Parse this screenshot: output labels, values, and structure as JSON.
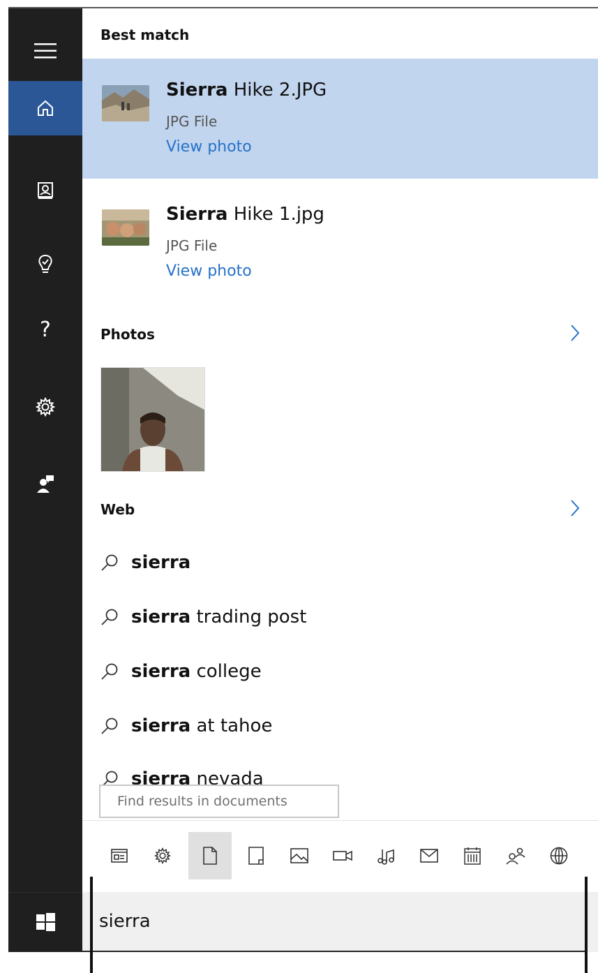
{
  "sections": {
    "best_match": "Best match",
    "photos": "Photos",
    "web": "Web"
  },
  "results": [
    {
      "title_bold": "Sierra",
      "title_rest": " Hike 2.JPG",
      "type": "JPG File",
      "action": "View photo",
      "selected": true
    },
    {
      "title_bold": "Sierra",
      "title_rest": " Hike 1.jpg",
      "type": "JPG File",
      "action": "View photo",
      "selected": false
    }
  ],
  "web_suggestions": [
    {
      "bold": "sierra",
      "rest": ""
    },
    {
      "bold": "sierra",
      "rest": " trading post"
    },
    {
      "bold": "sierra",
      "rest": " college"
    },
    {
      "bold": "sierra",
      "rest": " at tahoe"
    },
    {
      "bold": "sierra",
      "rest": " nevada"
    }
  ],
  "tooltip": "Find results in documents",
  "sidebar_icons": [
    "hamburger-icon",
    "home-icon",
    "notebook-icon",
    "lightbulb-icon",
    "help-icon",
    "gear-icon",
    "feedback-icon"
  ],
  "filter_icons": [
    "apps-icon",
    "settings-icon",
    "document-icon",
    "folder-icon",
    "photo-icon",
    "video-icon",
    "music-icon",
    "email-icon",
    "calendar-icon",
    "people-icon",
    "web-icon"
  ],
  "active_filter": "document-icon",
  "search": {
    "value": "sierra"
  },
  "colors": {
    "sidebar_bg": "#1f1f1f",
    "sidebar_active": "#2b5797",
    "selected_result": "#c2d5ef",
    "link": "#2672c9"
  }
}
